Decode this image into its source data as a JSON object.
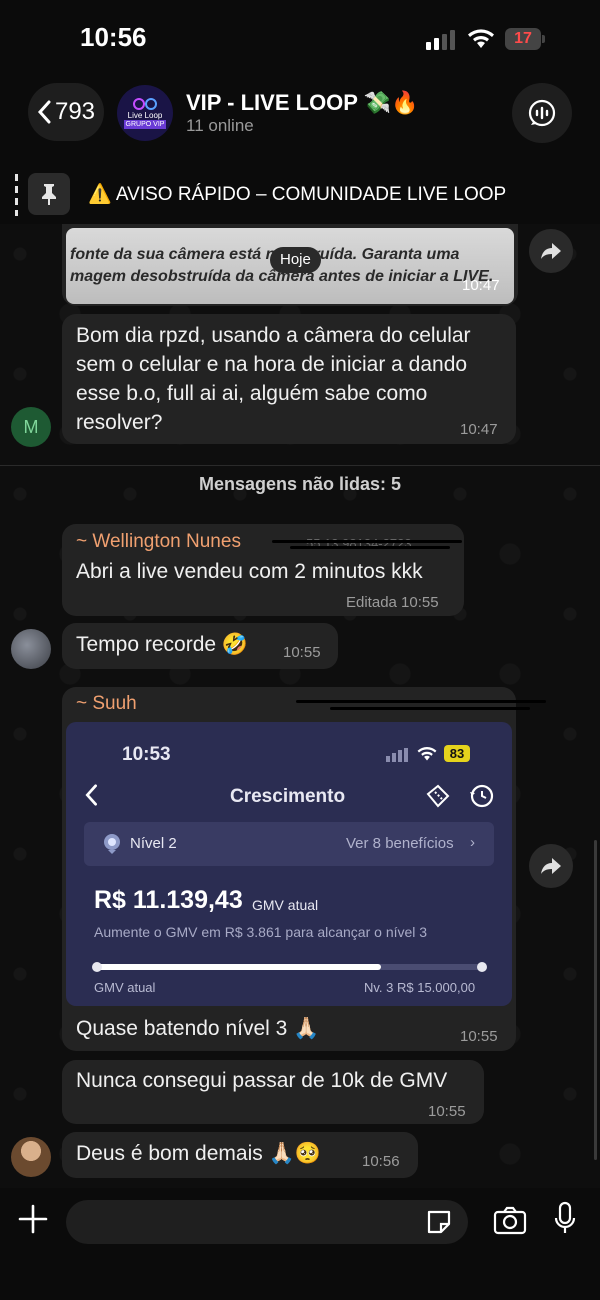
{
  "status_bar": {
    "time": "10:56",
    "battery": "17"
  },
  "header": {
    "back_count": "793",
    "title": "VIP - LIVE LOOP 💸🔥",
    "subtitle": "11 online",
    "avatar_text": "Live Loop",
    "avatar_sub": "GRUPO VIP"
  },
  "pinned": {
    "text": "⚠️ AVISO RÁPIDO – COMUNIDADE LIVE LOOP"
  },
  "date_pill": "Hoje",
  "messages": [
    {
      "image_lines": [
        "fonte da sua câmera está n    obstruída. Garanta uma",
        "magem desobstruída da câmera antes de iniciar a LIVE."
      ],
      "time": "10:47"
    },
    {
      "avatar_letter": "M",
      "text_lines": [
        "Bom dia rpzd, usando a câmera do celular",
        "sem o celular e na hora de iniciar a dando",
        "esse b.o, full ai ai, alguém sabe como",
        "resolver?"
      ],
      "time": "10:47"
    }
  ],
  "unread_label": "Mensagens não lidas: 5",
  "wellington": {
    "sender": "~ Wellington Nunes",
    "phone": "55 13 98134-2723",
    "text": "Abri a live vendeu com 2 minutos kkk",
    "time": "Editada 10:55",
    "text2": "Tempo recorde 🤣",
    "time2": "10:55"
  },
  "suuh": {
    "sender": "~ Suuh",
    "embed": {
      "time": "10:53",
      "battery": "83",
      "title": "Crescimento",
      "level": "Nível 2",
      "benefits": "Ver 8 benefícios",
      "gmv_value": "R$ 11.139,43",
      "gmv_label": "GMV atual",
      "hint": "Aumente o GMV em R$ 3.861 para alcançar o nível 3",
      "progress": 0.74,
      "left_label": "GMV atual",
      "right_label": "Nv. 3 R$ 15.000,00"
    },
    "caption": "Quase batendo nível 3 🙏🏻",
    "time": "10:55",
    "text2": "Nunca consegui passar de 10k de GMV",
    "time2": "10:55",
    "text3": "Deus é bom demais 🙏🏻🥺",
    "time3": "10:56"
  },
  "colors": {
    "sender_wellington": "#f0a070",
    "sender_suuh": "#f0a070",
    "bubble": "#232323",
    "embed_bg": "#2b2d52"
  }
}
